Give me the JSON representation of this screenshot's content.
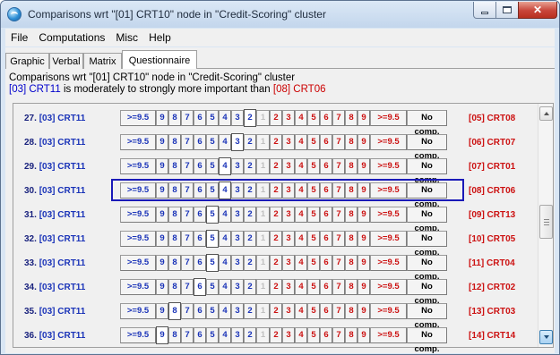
{
  "window": {
    "title": "Comparisons wrt \"[01] CRT10\" node in \"Credit-Scoring\" cluster"
  },
  "menu": [
    "File",
    "Computations",
    "Misc",
    "Help"
  ],
  "tabs": [
    "Graphic",
    "Verbal",
    "Matrix",
    "Questionnaire"
  ],
  "active_tab": "Questionnaire",
  "header": {
    "line1": "Comparisons wrt \"[01] CRT10\" node in \"Credit-Scoring\" cluster",
    "left_node": "[03] CRT11",
    "verbal": " is moderately to strongly more important than ",
    "right_node": "[08] CRT06"
  },
  "scale_cells": [
    ">=9.5",
    "9",
    "8",
    "7",
    "6",
    "5",
    "4",
    "3",
    "2",
    "1",
    "2",
    "3",
    "4",
    "5",
    "6",
    "7",
    "8",
    "9",
    ">=9.5",
    "No comp."
  ],
  "rows": [
    {
      "num": "27.",
      "left": "[03] CRT11",
      "right": "[05] CRT08",
      "selected_cell": 8
    },
    {
      "num": "28.",
      "left": "[03] CRT11",
      "right": "[06] CRT07",
      "selected_cell": 7
    },
    {
      "num": "29.",
      "left": "[03] CRT11",
      "right": "[07] CRT01",
      "selected_cell": 6
    },
    {
      "num": "30.",
      "left": "[03] CRT11",
      "right": "[08] CRT06",
      "selected_cell": 6,
      "focused": true
    },
    {
      "num": "31.",
      "left": "[03] CRT11",
      "right": "[09] CRT13",
      "selected_cell": 5
    },
    {
      "num": "32.",
      "left": "[03] CRT11",
      "right": "[10] CRT05",
      "selected_cell": 5
    },
    {
      "num": "33.",
      "left": "[03] CRT11",
      "right": "[11] CRT04",
      "selected_cell": 5
    },
    {
      "num": "34.",
      "left": "[03] CRT11",
      "right": "[12] CRT02",
      "selected_cell": 4
    },
    {
      "num": "35.",
      "left": "[03] CRT11",
      "right": "[13] CRT03",
      "selected_cell": 2
    },
    {
      "num": "36.",
      "left": "[03] CRT11",
      "right": "[14] CRT14",
      "selected_cell": 1
    }
  ],
  "colors": {
    "left_side": "#1a33b8",
    "right_side": "#cc1111",
    "focus_border": "#1a1ab8"
  },
  "icons": {
    "app": "ahp-app-icon",
    "minimize": "minimize-icon",
    "maximize": "maximize-icon",
    "close": "close-icon",
    "scroll_up": "scroll-up-arrow-icon",
    "scroll_down": "scroll-down-arrow-icon"
  }
}
